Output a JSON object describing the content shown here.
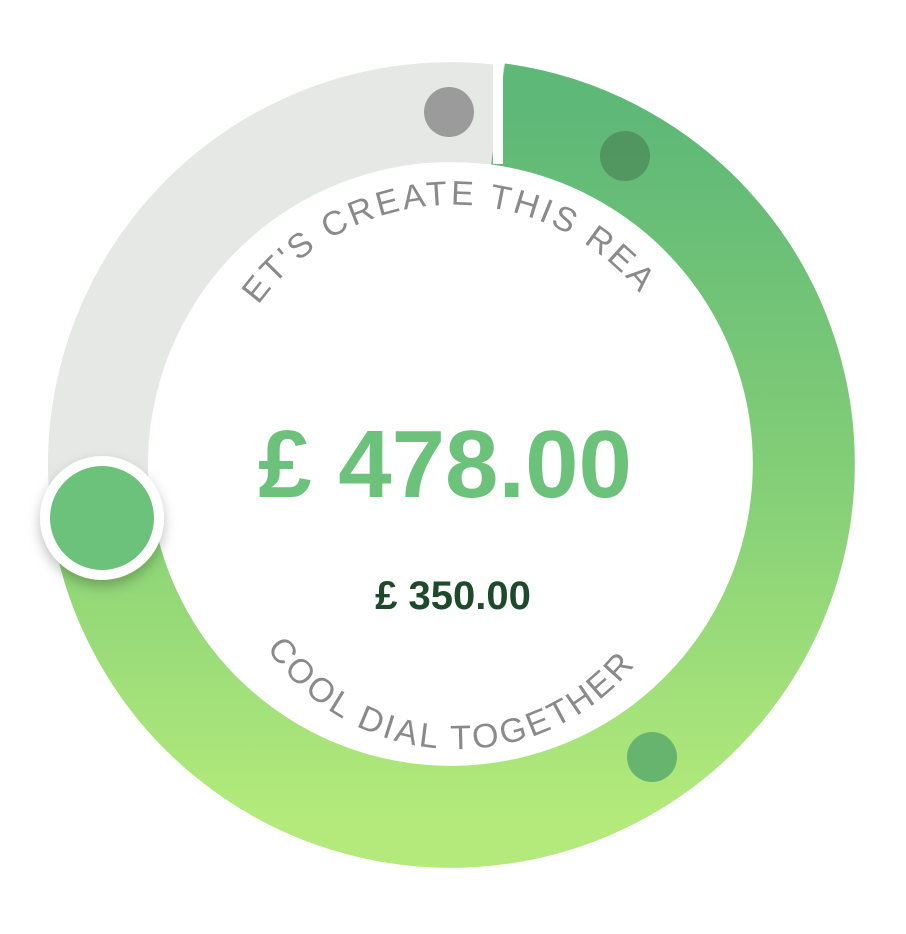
{
  "dial": {
    "top_text": "LET'S CREATE THIS REAL",
    "bottom_text": "COOL DIAL TOGETHER",
    "current_amount": "£ 478.00",
    "target_amount": "£ 350.00"
  },
  "colors": {
    "track": "#e6e8e6",
    "gradient_top": "#62bd78",
    "gradient_bottom": "#b0e87a",
    "knob": "#6cc27a",
    "main_amount": "#6cc27a",
    "sub_amount": "#1d4a2a",
    "arc_text": "#8a8a8a"
  },
  "icons": {
    "handle": "dial-handle-icon",
    "markers": [
      "marker-dot-icon",
      "marker-dot-icon",
      "marker-dot-icon"
    ]
  }
}
